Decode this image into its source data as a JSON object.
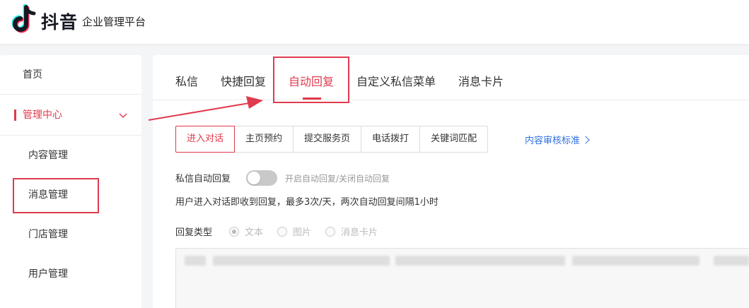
{
  "header": {
    "brand": "抖音",
    "platform": "企业管理平台"
  },
  "sidebar": {
    "items": [
      {
        "label": "首页"
      },
      {
        "label": "管理中心"
      },
      {
        "label": "内容管理"
      },
      {
        "label": "消息管理"
      },
      {
        "label": "门店管理"
      },
      {
        "label": "用户管理"
      }
    ]
  },
  "tabs": [
    {
      "label": "私信"
    },
    {
      "label": "快捷回复"
    },
    {
      "label": "自动回复"
    },
    {
      "label": "自定义私信菜单"
    },
    {
      "label": "消息卡片"
    }
  ],
  "subtabs": [
    {
      "label": "进入对话"
    },
    {
      "label": "主页预约"
    },
    {
      "label": "提交服务页"
    },
    {
      "label": "电话拨打"
    },
    {
      "label": "关键词匹配"
    }
  ],
  "review_link": "内容审核标准",
  "auto_reply": {
    "label": "私信自动回复",
    "toggle_on": false,
    "hint": "开启自动回复/关闭自动回复",
    "description": "用户进入对话即收到回复，最多3次/天，两次自动回复间隔1小时"
  },
  "reply_type": {
    "label": "回复类型",
    "options": [
      {
        "label": "文本",
        "checked": true
      },
      {
        "label": "图片",
        "checked": false
      },
      {
        "label": "消息卡片",
        "checked": false
      }
    ]
  },
  "colors": {
    "accent": "#e03a4d",
    "link": "#2f6fdf"
  }
}
